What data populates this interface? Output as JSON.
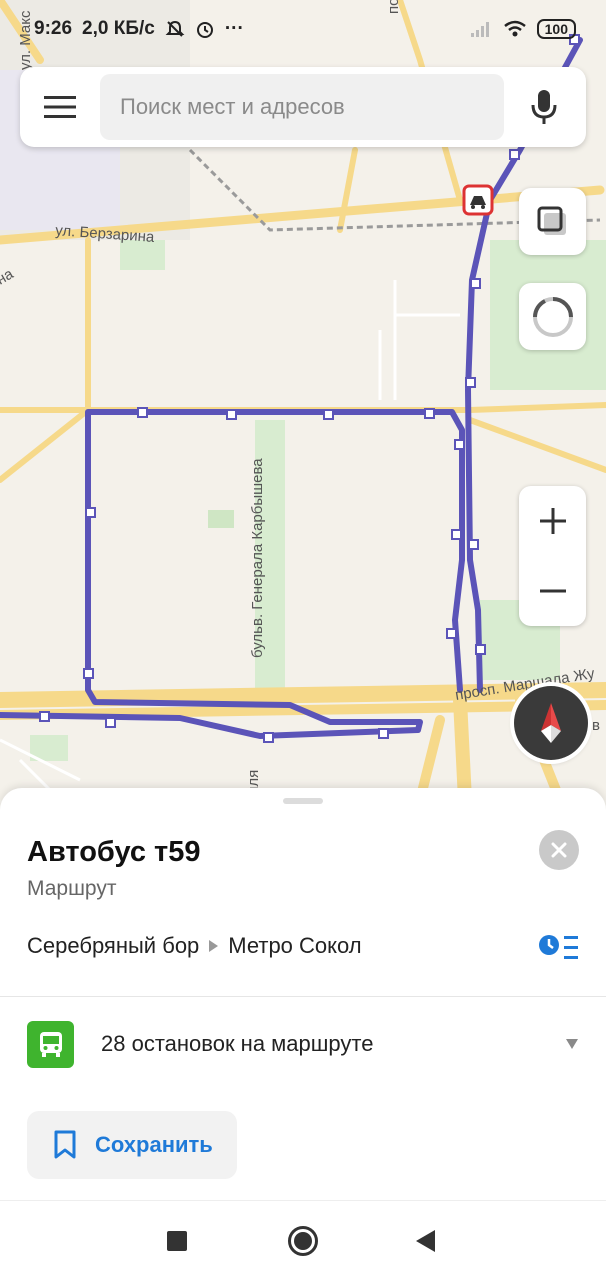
{
  "status_bar": {
    "time": "9:26",
    "speed": "2,0 КБ/с",
    "more": "···",
    "battery": "100"
  },
  "search": {
    "placeholder": "Поиск мест и адресов"
  },
  "map": {
    "streets": {
      "berzarina": "ул. Берзарина",
      "karbysheva": "бульв. Генерала Карбышева",
      "marshala": "просп. Маршала Жу",
      "maks": "ул. Макс",
      "na": "на",
      "ilya": "иля",
      "v": "в",
      "po": "по"
    },
    "route_color": "#5b54b8"
  },
  "sheet": {
    "title": "Автобус т59",
    "subtitle": "Маршрут",
    "from": "Серебряный бор",
    "to": "Метро Сокол",
    "stops_label": "28 остановок на маршруте",
    "save_label": "Сохранить"
  },
  "icons": {
    "menu": "hamburger-icon",
    "mic": "microphone-icon",
    "layers": "layers-icon",
    "traffic": "traffic-icon",
    "zoom_in": "plus-icon",
    "zoom_out": "minus-icon",
    "compass": "compass-icon",
    "close": "close-icon",
    "schedule": "schedule-icon",
    "bus": "bus-icon",
    "bookmark": "bookmark-icon"
  },
  "colors": {
    "accent": "#1f7ad8",
    "bus_green": "#3fb42e"
  }
}
